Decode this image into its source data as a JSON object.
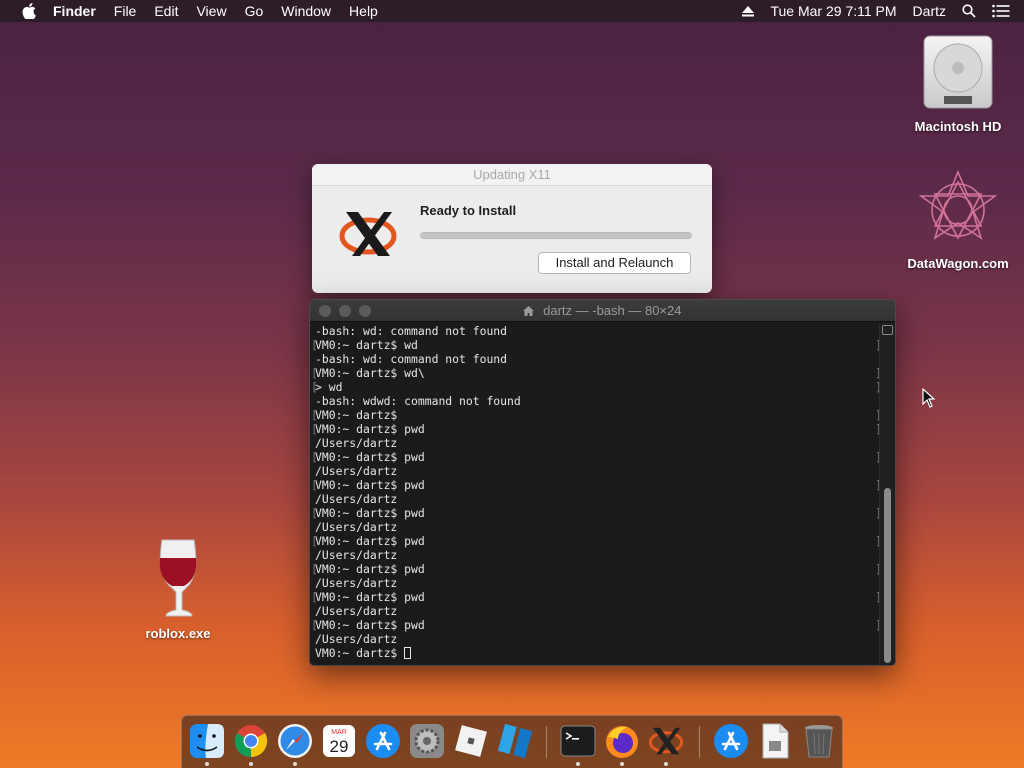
{
  "menubar": {
    "app_name": "Finder",
    "menus": [
      "File",
      "Edit",
      "View",
      "Go",
      "Window",
      "Help"
    ],
    "clock": "Tue Mar 29  7:11 PM",
    "user": "Dartz",
    "icons": [
      "eject-icon",
      "search-icon",
      "control-center-icon"
    ]
  },
  "desktop": {
    "items": [
      {
        "label": "Macintosh HD",
        "icon": "hard-drive-icon"
      },
      {
        "label": "DataWagon.com",
        "icon": "datawagon-logo-icon"
      },
      {
        "label": "roblox.exe",
        "icon": "wine-glass-icon"
      }
    ]
  },
  "updater": {
    "title": "Updating X11",
    "heading": "Ready to Install",
    "progress": 1.0,
    "button_label": "Install and Relaunch"
  },
  "terminal": {
    "title": "dartz — -bash — 80×24",
    "lines": [
      "-bash: wd: command not found",
      "VM0:~ dartz$ wd",
      "-bash: wd: command not found",
      "VM0:~ dartz$ wd\\",
      "> wd",
      "-bash: wdwd: command not found",
      "VM0:~ dartz$",
      "VM0:~ dartz$ pwd",
      "/Users/dartz",
      "VM0:~ dartz$ pwd",
      "/Users/dartz",
      "VM0:~ dartz$ pwd",
      "/Users/dartz",
      "VM0:~ dartz$ pwd",
      "/Users/dartz",
      "VM0:~ dartz$ pwd",
      "/Users/dartz",
      "VM0:~ dartz$ pwd",
      "/Users/dartz",
      "VM0:~ dartz$ pwd",
      "/Users/dartz",
      "VM0:~ dartz$ pwd",
      "/Users/dartz",
      "VM0:~ dartz$ "
    ]
  },
  "dock": {
    "calendar_month": "MAR",
    "calendar_day": "29",
    "apps": [
      {
        "name": "finder",
        "running": true
      },
      {
        "name": "chrome",
        "running": true
      },
      {
        "name": "safari",
        "running": true
      },
      {
        "name": "calendar",
        "running": false
      },
      {
        "name": "app-store",
        "running": false
      },
      {
        "name": "system-preferences",
        "running": false
      },
      {
        "name": "roblox",
        "running": false
      },
      {
        "name": "roblox-studio",
        "running": false
      },
      {
        "name": "terminal",
        "running": true
      },
      {
        "name": "firefox",
        "running": true
      },
      {
        "name": "x11",
        "running": true
      },
      {
        "name": "app-store-downloads",
        "running": false
      },
      {
        "name": "documents",
        "running": false
      },
      {
        "name": "trash",
        "running": false
      }
    ]
  },
  "colors": {
    "terminal_bg": "#1b1b1b",
    "terminal_text": "#e6e6e6",
    "dialog_bg": "#ececec"
  }
}
